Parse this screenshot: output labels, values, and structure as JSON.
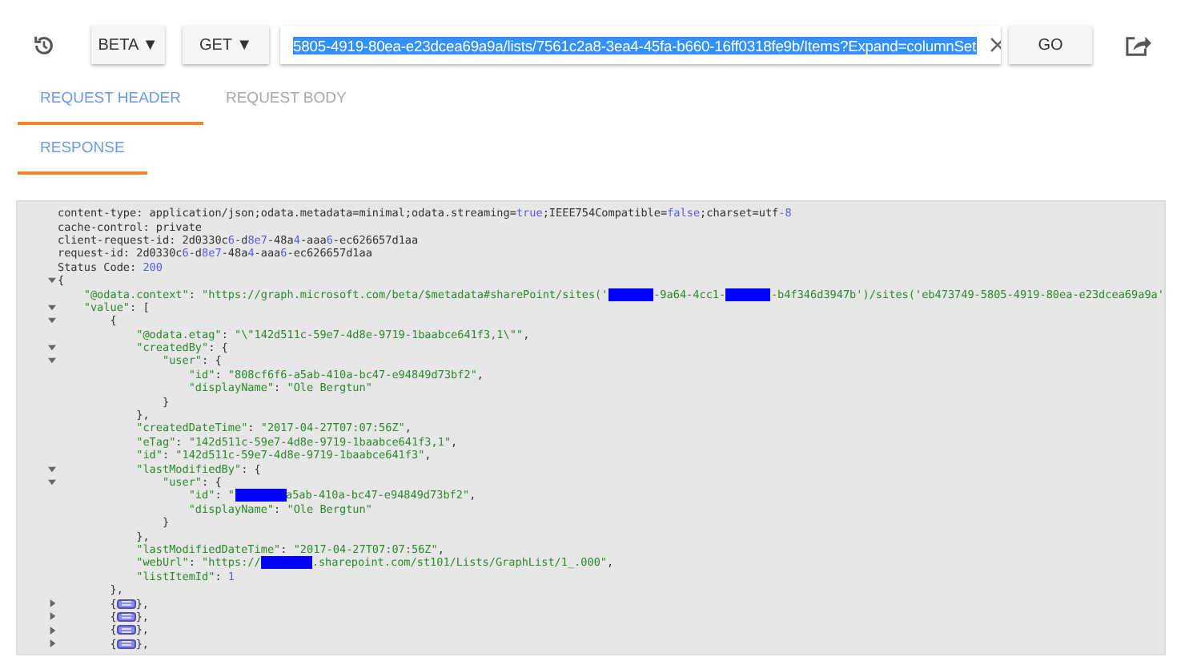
{
  "toolbar": {
    "version_button": "BETA ▼",
    "method_button": "GET ▼",
    "url": {
      "value": "5805-4919-80ea-e23dcea69a9a/lists/7561c2a8-3ea4-45fa-b660-16ff0318fe9b/Items?Expand=columnSet",
      "text_selected": true
    },
    "go_button": "GO"
  },
  "request_tabs": [
    {
      "label": "REQUEST HEADER",
      "selected": true,
      "disabled": false
    },
    {
      "label": "REQUEST BODY",
      "selected": false,
      "disabled": true
    }
  ],
  "response_tabs": [
    {
      "label": "RESPONSE",
      "selected": true,
      "disabled": false
    }
  ],
  "response_lines": [
    {
      "parts": [
        {
          "kind": "code",
          "tokens": [
            {
              "kind": "plain",
              "text": "content-type: application/json;odata.metadata=minimal;odata.streaming="
            },
            {
              "kind": "literal",
              "text": "true"
            },
            {
              "kind": "plain",
              "text": ";IEEE754Compatible="
            },
            {
              "kind": "literal",
              "text": "false"
            },
            {
              "kind": "plain",
              "text": ";charset=utf"
            },
            {
              "kind": "literal",
              "text": "-8"
            }
          ]
        }
      ]
    },
    {
      "parts": [
        {
          "kind": "code",
          "tokens": [
            {
              "kind": "plain",
              "text": "cache-control: private"
            }
          ]
        }
      ]
    },
    {
      "parts": [
        {
          "kind": "code",
          "tokens": [
            {
              "kind": "plain",
              "text": "client-request-id: 2d0330c"
            },
            {
              "kind": "literal",
              "text": "6"
            },
            {
              "kind": "plain",
              "text": "-d"
            },
            {
              "kind": "literal",
              "text": "8e7"
            },
            {
              "kind": "plain",
              "text": "-48a"
            },
            {
              "kind": "literal",
              "text": "4"
            },
            {
              "kind": "plain",
              "text": "-aaa"
            },
            {
              "kind": "literal",
              "text": "6"
            },
            {
              "kind": "plain",
              "text": "-ec626657d1aa"
            }
          ]
        }
      ]
    },
    {
      "parts": [
        {
          "kind": "code",
          "tokens": [
            {
              "kind": "plain",
              "text": "request-id: 2d0330c"
            },
            {
              "kind": "literal",
              "text": "6"
            },
            {
              "kind": "plain",
              "text": "-d"
            },
            {
              "kind": "literal",
              "text": "8e7"
            },
            {
              "kind": "plain",
              "text": "-48a"
            },
            {
              "kind": "literal",
              "text": "4"
            },
            {
              "kind": "plain",
              "text": "-aaa"
            },
            {
              "kind": "literal",
              "text": "6"
            },
            {
              "kind": "plain",
              "text": "-ec626657d1aa"
            }
          ]
        }
      ]
    },
    {
      "parts": [
        {
          "kind": "code",
          "tokens": [
            {
              "kind": "plain",
              "text": "Status Code: "
            },
            {
              "kind": "literal",
              "text": "200"
            }
          ]
        }
      ]
    },
    {
      "expanded": true,
      "parts": [
        {
          "kind": "code",
          "tokens": [
            {
              "kind": "plain",
              "text": "{"
            }
          ]
        }
      ]
    },
    {
      "parts": [
        {
          "kind": "code",
          "tokens": [
            {
              "kind": "string",
              "text": "    \"@odata.context\""
            },
            {
              "kind": "plain",
              "text": ": "
            },
            {
              "kind": "string",
              "text": "\"https://graph.microsoft.com/beta/$metadata#sharePoint/sites('"
            }
          ]
        },
        {
          "kind": "redacted"
        },
        {
          "kind": "code",
          "tokens": [
            {
              "kind": "string",
              "text": "-9a64-4cc1-"
            }
          ]
        },
        {
          "kind": "redacted"
        },
        {
          "kind": "code",
          "tokens": [
            {
              "kind": "string",
              "text": "-b4f346d3947b')/sites('eb473749-5805-4919-80ea-e23dcea69a9a'"
            }
          ]
        }
      ]
    },
    {
      "expanded": true,
      "parts": [
        {
          "kind": "code",
          "tokens": [
            {
              "kind": "string",
              "text": "    \"value\""
            },
            {
              "kind": "plain",
              "text": ": ["
            }
          ]
        }
      ]
    },
    {
      "expanded": true,
      "parts": [
        {
          "kind": "code",
          "tokens": [
            {
              "kind": "plain",
              "text": "        {"
            }
          ]
        }
      ]
    },
    {
      "parts": [
        {
          "kind": "code",
          "tokens": [
            {
              "kind": "string",
              "text": "            \"@odata.etag\""
            },
            {
              "kind": "plain",
              "text": ": "
            },
            {
              "kind": "string",
              "text": "\"\\\"142d511c-59e7-4d8e-9719-1baabce641f3,1\\\"\""
            },
            {
              "kind": "plain",
              "text": ","
            }
          ]
        }
      ]
    },
    {
      "expanded": true,
      "parts": [
        {
          "kind": "code",
          "tokens": [
            {
              "kind": "string",
              "text": "            \"createdBy\""
            },
            {
              "kind": "plain",
              "text": ": {"
            }
          ]
        }
      ]
    },
    {
      "expanded": true,
      "parts": [
        {
          "kind": "code",
          "tokens": [
            {
              "kind": "string",
              "text": "                \"user\""
            },
            {
              "kind": "plain",
              "text": ": {"
            }
          ]
        }
      ]
    },
    {
      "parts": [
        {
          "kind": "code",
          "tokens": [
            {
              "kind": "string",
              "text": "                    \"id\""
            },
            {
              "kind": "plain",
              "text": ": "
            },
            {
              "kind": "string",
              "text": "\"808cf6f6-a5ab-410a-bc47-e94849d73bf2\""
            },
            {
              "kind": "plain",
              "text": ","
            }
          ]
        }
      ]
    },
    {
      "parts": [
        {
          "kind": "code",
          "tokens": [
            {
              "kind": "string",
              "text": "                    \"displayName\""
            },
            {
              "kind": "plain",
              "text": ": "
            },
            {
              "kind": "string",
              "text": "\"Ole Bergtun\""
            }
          ]
        }
      ]
    },
    {
      "parts": [
        {
          "kind": "code",
          "tokens": [
            {
              "kind": "plain",
              "text": "                }"
            }
          ]
        }
      ]
    },
    {
      "parts": [
        {
          "kind": "code",
          "tokens": [
            {
              "kind": "plain",
              "text": "            },"
            }
          ]
        }
      ]
    },
    {
      "parts": [
        {
          "kind": "code",
          "tokens": [
            {
              "kind": "string",
              "text": "            \"createdDateTime\""
            },
            {
              "kind": "plain",
              "text": ": "
            },
            {
              "kind": "string",
              "text": "\"2017-04-27T07:07:56Z\""
            },
            {
              "kind": "plain",
              "text": ","
            }
          ]
        }
      ]
    },
    {
      "parts": [
        {
          "kind": "code",
          "tokens": [
            {
              "kind": "string",
              "text": "            \"eTag\""
            },
            {
              "kind": "plain",
              "text": ": "
            },
            {
              "kind": "string",
              "text": "\"142d511c-59e7-4d8e-9719-1baabce641f3,1\""
            },
            {
              "kind": "plain",
              "text": ","
            }
          ]
        }
      ]
    },
    {
      "parts": [
        {
          "kind": "code",
          "tokens": [
            {
              "kind": "string",
              "text": "            \"id\""
            },
            {
              "kind": "plain",
              "text": ": "
            },
            {
              "kind": "string",
              "text": "\"142d511c-59e7-4d8e-9719-1baabce641f3\""
            },
            {
              "kind": "plain",
              "text": ","
            }
          ]
        }
      ]
    },
    {
      "expanded": true,
      "parts": [
        {
          "kind": "code",
          "tokens": [
            {
              "kind": "string",
              "text": "            \"lastModifiedBy\""
            },
            {
              "kind": "plain",
              "text": ": {"
            }
          ]
        }
      ]
    },
    {
      "expanded": true,
      "parts": [
        {
          "kind": "code",
          "tokens": [
            {
              "kind": "string",
              "text": "                \"user\""
            },
            {
              "kind": "plain",
              "text": ": {"
            }
          ]
        }
      ]
    },
    {
      "parts": [
        {
          "kind": "code",
          "tokens": [
            {
              "kind": "string",
              "text": "                    \"id\""
            },
            {
              "kind": "plain",
              "text": ": "
            },
            {
              "kind": "string",
              "text": "\""
            }
          ]
        },
        {
          "kind": "redacted"
        },
        {
          "kind": "code",
          "tokens": [
            {
              "kind": "string",
              "text": "a5ab-410a-bc47-e94849d73bf2\""
            },
            {
              "kind": "plain",
              "text": ","
            }
          ]
        }
      ]
    },
    {
      "parts": [
        {
          "kind": "code",
          "tokens": [
            {
              "kind": "string",
              "text": "                    \"displayName\""
            },
            {
              "kind": "plain",
              "text": ": "
            },
            {
              "kind": "string",
              "text": "\"Ole Bergtun\""
            }
          ]
        }
      ]
    },
    {
      "parts": [
        {
          "kind": "code",
          "tokens": [
            {
              "kind": "plain",
              "text": "                }"
            }
          ]
        }
      ]
    },
    {
      "parts": [
        {
          "kind": "code",
          "tokens": [
            {
              "kind": "plain",
              "text": "            },"
            }
          ]
        }
      ]
    },
    {
      "parts": [
        {
          "kind": "code",
          "tokens": [
            {
              "kind": "string",
              "text": "            \"lastModifiedDateTime\""
            },
            {
              "kind": "plain",
              "text": ": "
            },
            {
              "kind": "string",
              "text": "\"2017-04-27T07:07:56Z\""
            },
            {
              "kind": "plain",
              "text": ","
            }
          ]
        }
      ]
    },
    {
      "parts": [
        {
          "kind": "code",
          "tokens": [
            {
              "kind": "string",
              "text": "            \"webUrl\""
            },
            {
              "kind": "plain",
              "text": ": "
            },
            {
              "kind": "string",
              "text": "\"https://"
            }
          ]
        },
        {
          "kind": "redacted"
        },
        {
          "kind": "code",
          "tokens": [
            {
              "kind": "string",
              "text": ".sharepoint.com/st101/Lists/GraphList/1_.000\""
            },
            {
              "kind": "plain",
              "text": ","
            }
          ]
        }
      ]
    },
    {
      "parts": [
        {
          "kind": "code",
          "tokens": [
            {
              "kind": "string",
              "text": "            \"listItemId\""
            },
            {
              "kind": "plain",
              "text": ": "
            },
            {
              "kind": "literal",
              "text": "1"
            }
          ]
        }
      ]
    },
    {
      "parts": [
        {
          "kind": "code",
          "tokens": [
            {
              "kind": "plain",
              "text": "        },"
            }
          ]
        }
      ]
    },
    {
      "expanded": false,
      "parts": [
        {
          "kind": "code",
          "tokens": [
            {
              "kind": "plain",
              "text": "        {"
            }
          ]
        },
        {
          "kind": "collapsed"
        },
        {
          "kind": "code",
          "tokens": [
            {
              "kind": "plain",
              "text": "},"
            }
          ]
        }
      ]
    },
    {
      "expanded": false,
      "parts": [
        {
          "kind": "code",
          "tokens": [
            {
              "kind": "plain",
              "text": "        {"
            }
          ]
        },
        {
          "kind": "collapsed"
        },
        {
          "kind": "code",
          "tokens": [
            {
              "kind": "plain",
              "text": "},"
            }
          ]
        }
      ]
    },
    {
      "expanded": false,
      "parts": [
        {
          "kind": "code",
          "tokens": [
            {
              "kind": "plain",
              "text": "        {"
            }
          ]
        },
        {
          "kind": "collapsed"
        },
        {
          "kind": "code",
          "tokens": [
            {
              "kind": "plain",
              "text": "},"
            }
          ]
        }
      ]
    },
    {
      "expanded": false,
      "parts": [
        {
          "kind": "code",
          "tokens": [
            {
              "kind": "plain",
              "text": "        {"
            }
          ]
        },
        {
          "kind": "collapsed"
        },
        {
          "kind": "code",
          "tokens": [
            {
              "kind": "plain",
              "text": "},"
            }
          ]
        }
      ]
    }
  ]
}
